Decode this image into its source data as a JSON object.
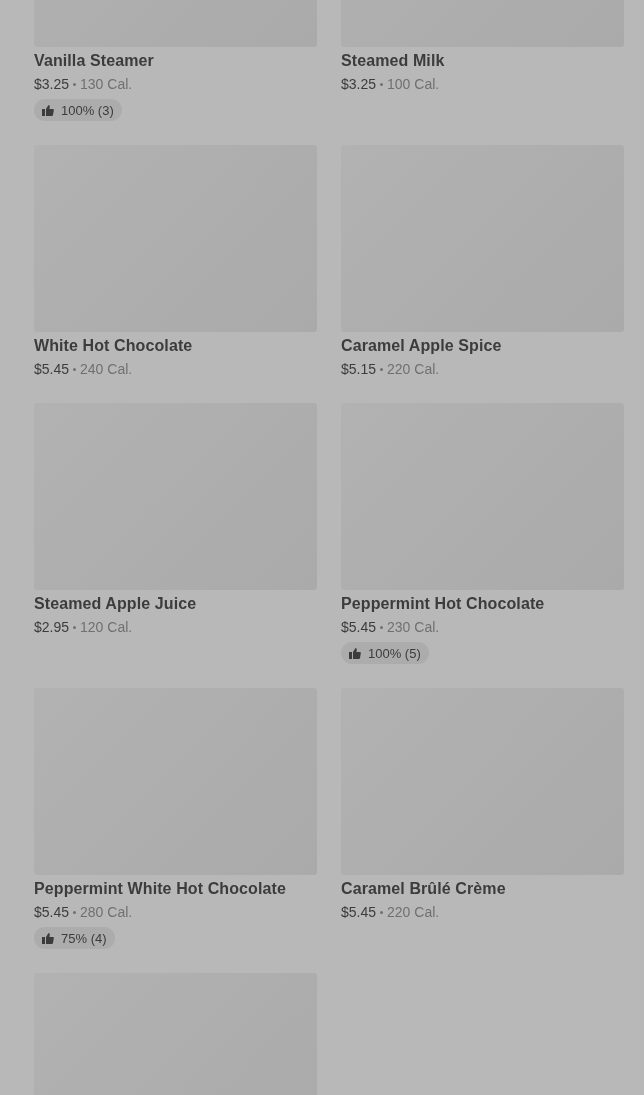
{
  "items": [
    {
      "kind": "product",
      "name": "Vanilla Steamer",
      "price": "$3.25",
      "calories": "130 Cal.",
      "rating": "100% (3)"
    },
    {
      "kind": "product",
      "name": "Steamed Milk",
      "price": "$3.25",
      "calories": "100 Cal."
    },
    {
      "kind": "product",
      "name": "White Hot Chocolate",
      "price": "$5.45",
      "calories": "240 Cal."
    },
    {
      "kind": "product",
      "name": "Caramel Apple Spice",
      "price": "$5.15",
      "calories": "220 Cal."
    },
    {
      "kind": "product",
      "name": "Steamed Apple Juice",
      "price": "$2.95",
      "calories": "120 Cal."
    },
    {
      "kind": "product",
      "name": "Peppermint Hot Chocolate",
      "price": "$5.45",
      "calories": "230 Cal.",
      "rating": "100% (5)"
    },
    {
      "kind": "product",
      "name": "Peppermint White Hot Chocolate",
      "price": "$5.45",
      "calories": "280 Cal.",
      "rating": "75% (4)"
    },
    {
      "kind": "product",
      "name": "Caramel Brûlé Crème",
      "price": "$5.45",
      "calories": "220 Cal."
    },
    {
      "kind": "image_only"
    }
  ]
}
